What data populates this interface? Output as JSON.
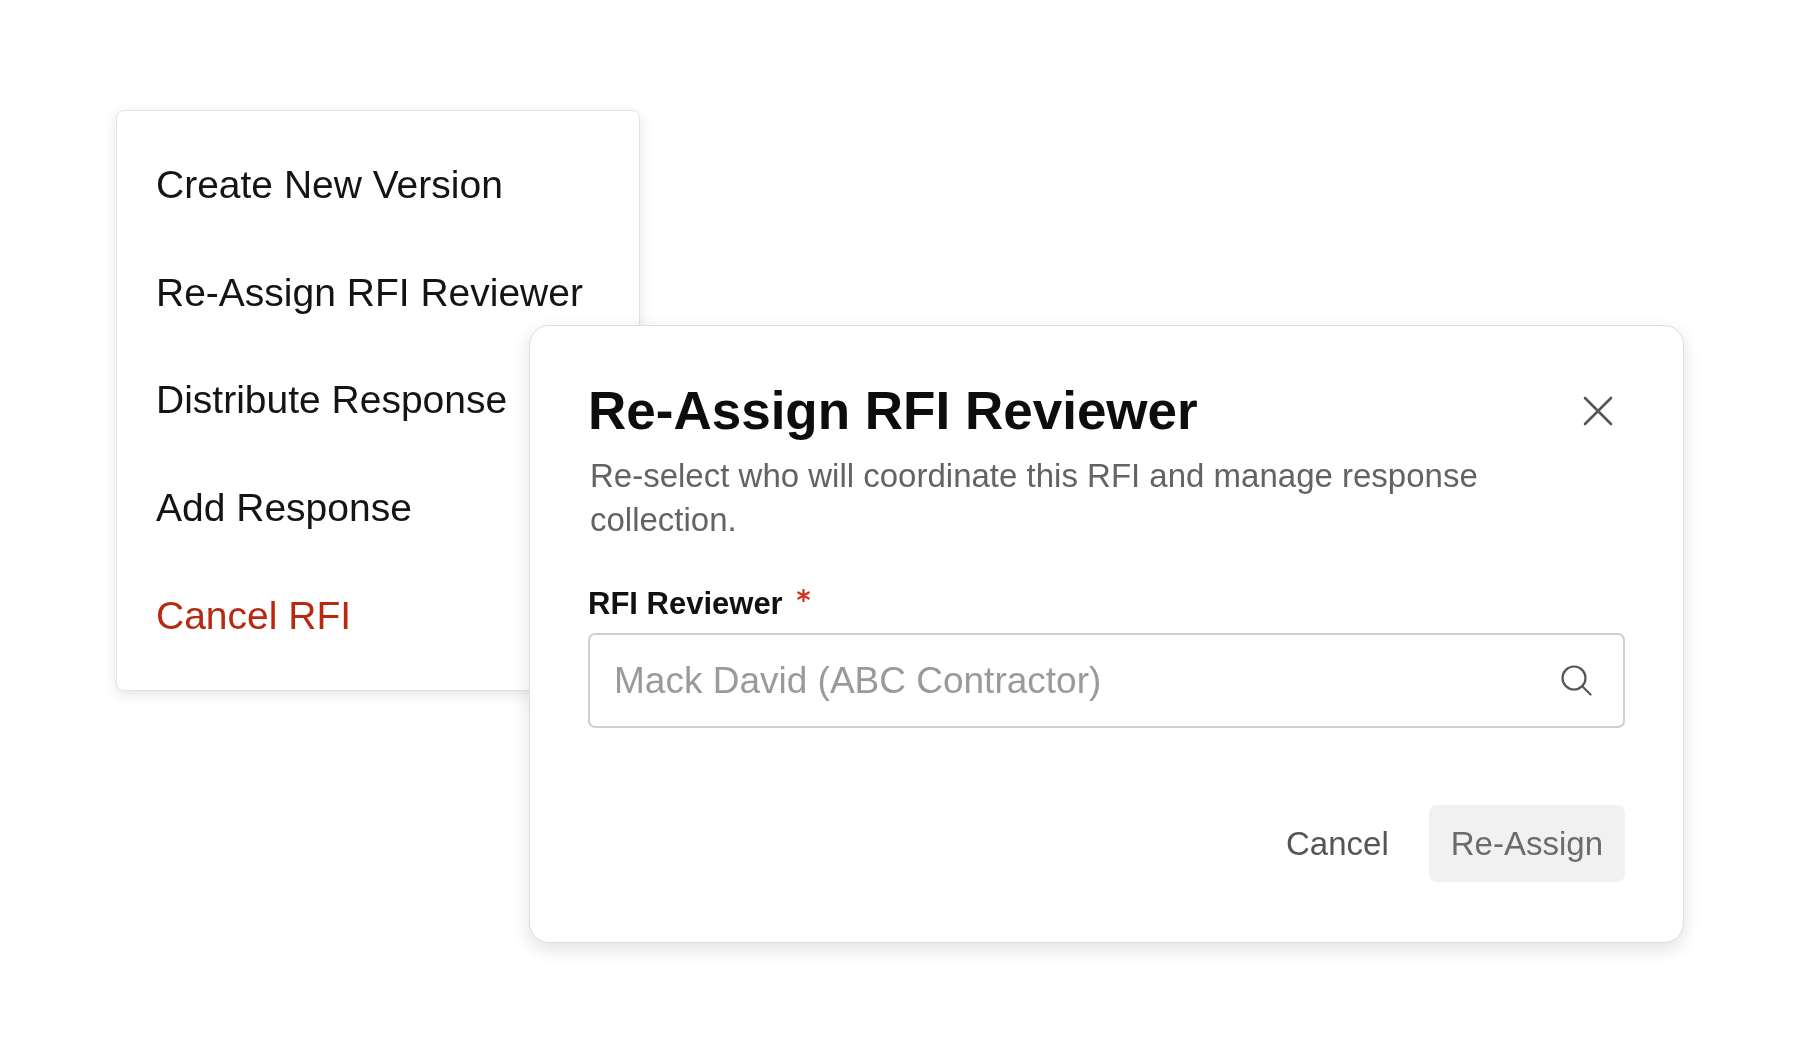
{
  "menu": {
    "items": [
      {
        "label": "Create New Version",
        "kind": "default"
      },
      {
        "label": "Re-Assign RFI Reviewer",
        "kind": "default"
      },
      {
        "label": "Distribute Response",
        "kind": "default"
      },
      {
        "label": "Add Response",
        "kind": "default"
      },
      {
        "label": "Cancel RFI",
        "kind": "danger"
      }
    ]
  },
  "dialog": {
    "title": "Re-Assign RFI Reviewer",
    "description": "Re-select who will coordinate this RFI and manage response collection.",
    "field": {
      "label": "RFI Reviewer",
      "required": true,
      "placeholder": "Mack David (ABC Contractor)"
    },
    "buttons": [
      {
        "label": "Cancel",
        "kind": "text",
        "disabled": false
      },
      {
        "label": "Re-Assign",
        "kind": "primary",
        "disabled": true
      }
    ]
  }
}
